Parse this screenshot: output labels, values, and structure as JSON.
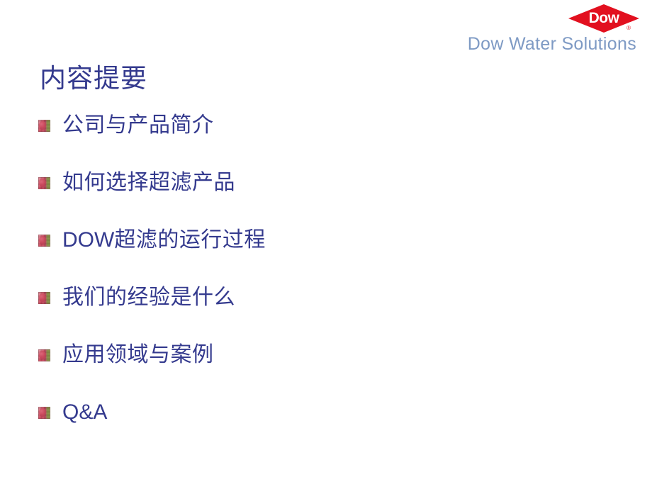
{
  "slide": {
    "background_color": "#ffffff",
    "title": "内容提要",
    "title_color": "#343a8e"
  },
  "brand": {
    "logo_name": "dow-diamond-logo",
    "logo_word": "Dow",
    "logo_color": "#e2101f",
    "logo_word_color": "#ffffff",
    "registered_mark": "®",
    "tagline": "Dow Water Solutions",
    "tagline_color": "#7e9ac4"
  },
  "bullets": {
    "marker_icon": "picture-bullet-icon",
    "text_color": "#343a8e",
    "items": [
      {
        "label": "公司与产品简介",
        "script": "cjk"
      },
      {
        "label": "如何选择超滤产品",
        "script": "cjk"
      },
      {
        "label": "DOW超滤的运行过程",
        "script": "mixed",
        "latin_prefix": "DOW",
        "cjk_suffix": "超滤的运行过程"
      },
      {
        "label": "我们的经验是什么",
        "script": "cjk"
      },
      {
        "label": "应用领域与案例",
        "script": "cjk"
      },
      {
        "label": "Q&A",
        "script": "latin"
      }
    ]
  }
}
